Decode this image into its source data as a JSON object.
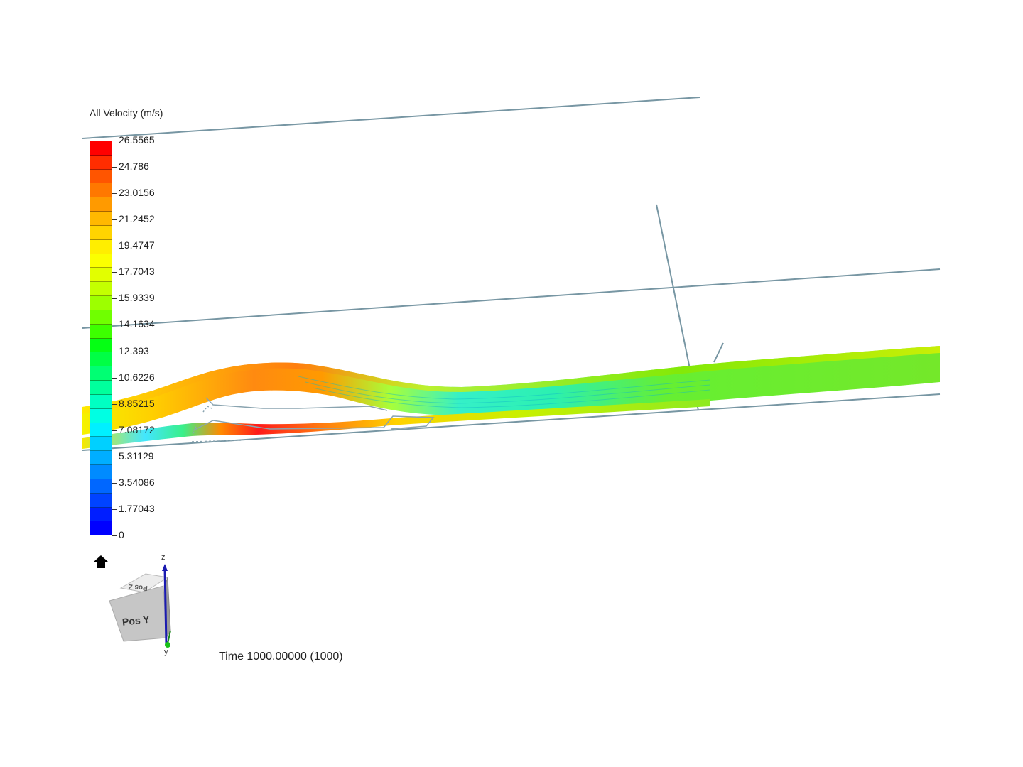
{
  "legend": {
    "title": "All Velocity (m/s)",
    "ticks": [
      "26.5565",
      "24.786",
      "23.0156",
      "21.2452",
      "19.4747",
      "17.7043",
      "15.9339",
      "14.1634",
      "12.393",
      "10.6226",
      "8.85215",
      "7.08172",
      "5.31129",
      "3.54086",
      "1.77043",
      "0"
    ],
    "band_colors": [
      "#ff0000",
      "#ff2d00",
      "#ff5500",
      "#ff7800",
      "#ff9a00",
      "#ffb800",
      "#ffd400",
      "#ffee00",
      "#fbff00",
      "#e2ff00",
      "#c4ff00",
      "#9dff00",
      "#70ff00",
      "#3dff00",
      "#05ff14",
      "#00ff45",
      "#00ff73",
      "#00ff9c",
      "#00ffc2",
      "#00ffe3",
      "#00f0ff",
      "#00d0ff",
      "#00aeff",
      "#008bff",
      "#0067ff",
      "#0043ff",
      "#001eff",
      "#0000ff"
    ]
  },
  "view_cube": {
    "face_front": "Pos Y",
    "face_top": "Pos Z",
    "axis_z": "z",
    "axis_y": "y"
  },
  "status": {
    "time": "Time 1000.00000 (1000)"
  },
  "icons": {
    "home": "home-icon"
  }
}
